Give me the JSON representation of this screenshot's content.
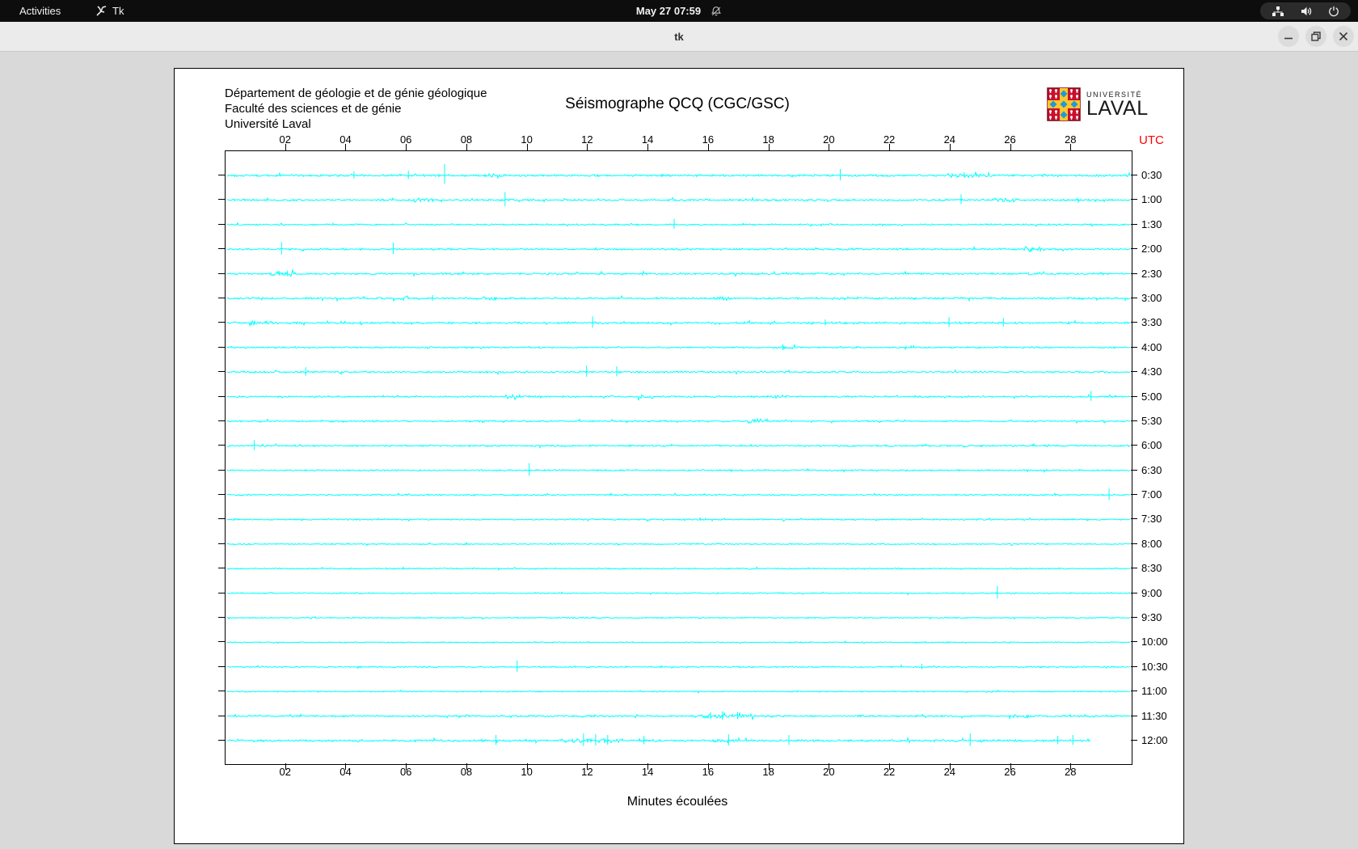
{
  "top_bar": {
    "activities_label": "Activities",
    "app_name": "Tk",
    "clock": "May 27  07:59"
  },
  "title_bar": {
    "title": "tk"
  },
  "canvas": {
    "header_lines": "Département de géologie et de génie géologique\nFaculté des sciences et de génie\nUniversité Laval",
    "logo": {
      "line1": "UNIVERSITÉ",
      "line2": "LAVAL"
    }
  },
  "colors": {
    "trace": "#00ffff",
    "utc_red": "#ff0000",
    "logo_red": "#c8102e",
    "logo_yellow": "#ffc72c",
    "logo_blue": "#1f9ad6"
  },
  "chart_data": {
    "type": "line",
    "title": "Séismographe QCQ (CGC/GSC)",
    "xlabel": "Minutes écoulées",
    "right_axis_label": "UTC",
    "x_range": [
      0,
      30
    ],
    "x_ticks": [
      {
        "m": 2,
        "label": "02"
      },
      {
        "m": 4,
        "label": "04"
      },
      {
        "m": 6,
        "label": "06"
      },
      {
        "m": 8,
        "label": "08"
      },
      {
        "m": 10,
        "label": "10"
      },
      {
        "m": 12,
        "label": "12"
      },
      {
        "m": 14,
        "label": "14"
      },
      {
        "m": 16,
        "label": "16"
      },
      {
        "m": 18,
        "label": "18"
      },
      {
        "m": 20,
        "label": "20"
      },
      {
        "m": 22,
        "label": "22"
      },
      {
        "m": 24,
        "label": "24"
      },
      {
        "m": 26,
        "label": "26"
      },
      {
        "m": 28,
        "label": "28"
      }
    ],
    "grid": false,
    "legend": "none",
    "trace_color": "#00ffff",
    "rows": [
      {
        "label": "0:30",
        "noise": 1.5,
        "end": 30,
        "spikes": [
          [
            4.2,
            5
          ],
          [
            6.0,
            6
          ],
          [
            7.2,
            14
          ],
          [
            20.3,
            8
          ],
          [
            24.4,
            4
          ]
        ],
        "bursts": [
          [
            8.5,
            9.2,
            2.2
          ],
          [
            23.8,
            25.3,
            2.0
          ]
        ]
      },
      {
        "label": "1:00",
        "noise": 1.4,
        "end": 30,
        "spikes": [
          [
            9.2,
            10
          ],
          [
            24.3,
            7
          ]
        ],
        "bursts": [
          [
            6.2,
            6.9,
            2.5
          ],
          [
            14.6,
            15.0,
            1.8
          ],
          [
            25.4,
            26.2,
            2.6
          ]
        ]
      },
      {
        "label": "1:30",
        "noise": 1.1,
        "end": 30,
        "spikes": [
          [
            14.8,
            7
          ]
        ],
        "bursts": []
      },
      {
        "label": "2:00",
        "noise": 1.3,
        "end": 30,
        "spikes": [
          [
            1.8,
            9
          ],
          [
            5.5,
            8
          ]
        ],
        "bursts": [
          [
            26.4,
            27.1,
            2.6
          ]
        ]
      },
      {
        "label": "2:30",
        "noise": 1.4,
        "end": 30,
        "spikes": [
          [
            2.0,
            4
          ]
        ],
        "bursts": [
          [
            1.4,
            2.3,
            2.6
          ],
          [
            26.2,
            26.9,
            2.2
          ]
        ]
      },
      {
        "label": "3:00",
        "noise": 1.4,
        "end": 30,
        "spikes": [
          [
            6.8,
            4
          ]
        ],
        "bursts": [
          [
            5.3,
            6.0,
            2.4
          ],
          [
            8.5,
            9.0,
            2.0
          ],
          [
            16.2,
            16.6,
            1.8
          ]
        ]
      },
      {
        "label": "3:30",
        "noise": 1.4,
        "end": 30,
        "spikes": [
          [
            12.1,
            8
          ],
          [
            19.8,
            4
          ],
          [
            23.9,
            7
          ],
          [
            25.7,
            6
          ]
        ],
        "bursts": [
          [
            0.7,
            1.5,
            2.4
          ]
        ]
      },
      {
        "label": "4:00",
        "noise": 1.1,
        "end": 30,
        "spikes": [
          [
            18.4,
            4
          ]
        ],
        "bursts": [
          [
            18.1,
            18.8,
            2.0
          ]
        ]
      },
      {
        "label": "4:30",
        "noise": 1.3,
        "end": 30,
        "spikes": [
          [
            2.6,
            6
          ],
          [
            11.9,
            8
          ],
          [
            12.9,
            7
          ]
        ],
        "bursts": []
      },
      {
        "label": "5:00",
        "noise": 1.2,
        "end": 30,
        "spikes": [
          [
            28.6,
            7
          ]
        ],
        "bursts": [
          [
            9.2,
            9.9,
            2.4
          ],
          [
            13.6,
            14.1,
            2.0
          ],
          [
            18.1,
            18.6,
            2.0
          ]
        ]
      },
      {
        "label": "5:30",
        "noise": 1.1,
        "end": 30,
        "spikes": [],
        "bursts": [
          [
            17.2,
            17.9,
            2.8
          ]
        ]
      },
      {
        "label": "6:00",
        "noise": 1.2,
        "end": 30,
        "spikes": [
          [
            0.9,
            7
          ]
        ],
        "bursts": []
      },
      {
        "label": "6:30",
        "noise": 1.1,
        "end": 30,
        "spikes": [
          [
            10.0,
            9
          ]
        ],
        "bursts": []
      },
      {
        "label": "7:00",
        "noise": 1.0,
        "end": 30,
        "spikes": [
          [
            29.2,
            8
          ]
        ],
        "bursts": []
      },
      {
        "label": "7:30",
        "noise": 1.0,
        "end": 30,
        "spikes": [],
        "bursts": []
      },
      {
        "label": "8:00",
        "noise": 0.9,
        "end": 30,
        "spikes": [],
        "bursts": []
      },
      {
        "label": "8:30",
        "noise": 0.9,
        "end": 30,
        "spikes": [],
        "bursts": []
      },
      {
        "label": "9:00",
        "noise": 0.9,
        "end": 30,
        "spikes": [
          [
            25.5,
            9
          ]
        ],
        "bursts": []
      },
      {
        "label": "9:30",
        "noise": 0.9,
        "end": 30,
        "spikes": [],
        "bursts": []
      },
      {
        "label": "10:00",
        "noise": 0.8,
        "end": 30,
        "spikes": [],
        "bursts": []
      },
      {
        "label": "10:30",
        "noise": 1.0,
        "end": 30,
        "spikes": [
          [
            9.6,
            8
          ],
          [
            23.0,
            4
          ]
        ],
        "bursts": []
      },
      {
        "label": "11:00",
        "noise": 0.8,
        "end": 30,
        "spikes": [],
        "bursts": []
      },
      {
        "label": "11:30",
        "noise": 1.3,
        "end": 30,
        "spikes": [
          [
            16.0,
            5
          ],
          [
            16.4,
            6
          ],
          [
            16.9,
            5
          ]
        ],
        "bursts": [
          [
            15.7,
            17.4,
            2.2
          ],
          [
            25.9,
            26.6,
            2.4
          ]
        ]
      },
      {
        "label": "12:00",
        "noise": 1.5,
        "end": 28.6,
        "spikes": [
          [
            8.9,
            7
          ],
          [
            11.8,
            9
          ],
          [
            12.2,
            8
          ],
          [
            12.6,
            7
          ],
          [
            13.8,
            6
          ],
          [
            16.6,
            8
          ],
          [
            18.6,
            7
          ],
          [
            24.6,
            9
          ],
          [
            27.5,
            6
          ],
          [
            28.0,
            7
          ]
        ],
        "bursts": [
          [
            11.4,
            13.1,
            2.0
          ],
          [
            16.0,
            17.0,
            1.8
          ]
        ]
      }
    ]
  }
}
